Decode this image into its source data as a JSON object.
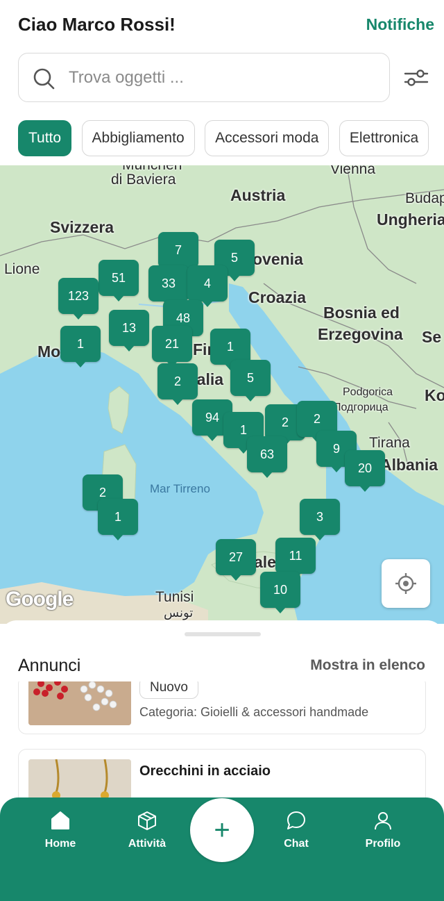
{
  "header": {
    "greeting": "Ciao Marco Rossi!",
    "notifications": "Notifiche"
  },
  "search": {
    "placeholder": "Trova oggetti ..."
  },
  "categories": [
    {
      "label": "Tutto",
      "active": true
    },
    {
      "label": "Abbigliamento",
      "active": false
    },
    {
      "label": "Accessori moda",
      "active": false
    },
    {
      "label": "Elettronica",
      "active": false
    }
  ],
  "map": {
    "labels": {
      "baviera": "di Baviera",
      "austria": "Austria",
      "vienna": "Vienna",
      "budapest": "Budap",
      "svizzera": "Svizzera",
      "ungheria": "Ungheria",
      "lione": "Lione",
      "slovenia": "ovenia",
      "croazia": "Croazia",
      "bosnia1": "Bosnia ed",
      "bosnia2": "Erzegovina",
      "serbia": "Se",
      "monaco": "Mo",
      "firenze": "Fire",
      "italia": "talia",
      "podgorica1": "Podgorica",
      "podgorica2": "Подгорица",
      "kosovo": "Ko",
      "tirana": "Tirana",
      "albania": "Albania",
      "mar_tirreno": "Mar Tirreno",
      "palermo": "ale",
      "tunisi": "Tunisi",
      "tunisi_ar": "تونس",
      "monaco_top": "München"
    },
    "clusters": [
      "7",
      "5",
      "51",
      "33",
      "4",
      "123",
      "48",
      "13",
      "21",
      "1",
      "1",
      "5",
      "2",
      "94",
      "1",
      "2",
      "2",
      "63",
      "9",
      "20",
      "2",
      "1",
      "3",
      "27",
      "11",
      "10"
    ],
    "google": "Google"
  },
  "sheet": {
    "title": "Annunci",
    "show_list": "Mostra in elenco",
    "items": [
      {
        "badge": "Nuovo",
        "category": "Categoria: Gioielli & accessori handmade"
      },
      {
        "title": "Orecchini in acciaio"
      }
    ]
  },
  "nav": {
    "home": "Home",
    "activity": "Attività",
    "add": "+",
    "chat": "Chat",
    "profile": "Profilo"
  },
  "colors": {
    "accent": "#17876b",
    "sea": "#8fd3ec",
    "land": "#cfe6c7"
  }
}
